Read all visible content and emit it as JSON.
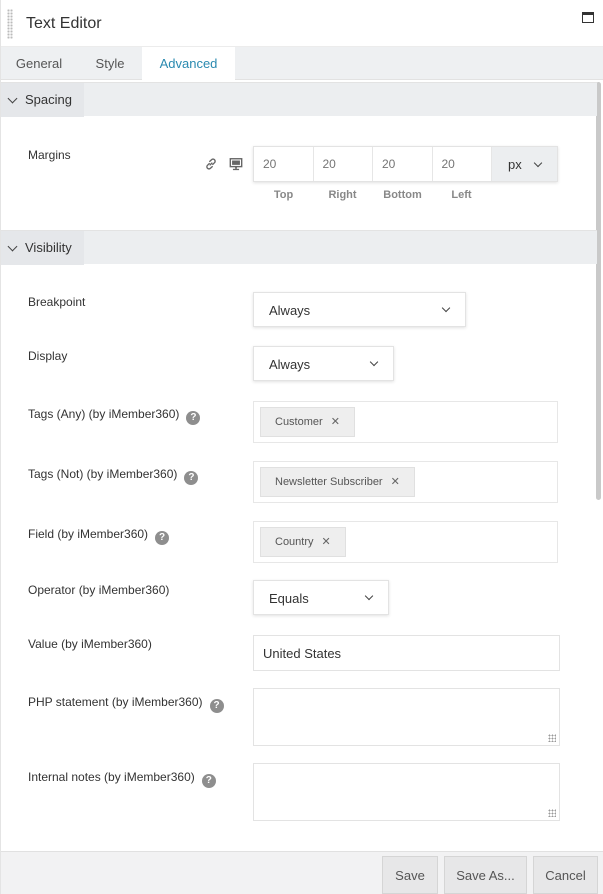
{
  "header": {
    "title": "Text Editor"
  },
  "tabs": [
    {
      "label": "General"
    },
    {
      "label": "Style"
    },
    {
      "label": "Advanced"
    }
  ],
  "active_tab": "Advanced",
  "accent_color": "#2a8ab0",
  "spacing": {
    "section_label": "Spacing",
    "margins": {
      "label": "Margins",
      "top": {
        "placeholder": "20",
        "caption": "Top"
      },
      "right": {
        "placeholder": "20",
        "caption": "Right"
      },
      "bottom": {
        "placeholder": "20",
        "caption": "Bottom"
      },
      "left": {
        "placeholder": "20",
        "caption": "Left"
      },
      "unit": "px"
    }
  },
  "visibility": {
    "section_label": "Visibility",
    "breakpoint": {
      "label": "Breakpoint",
      "value": "Always"
    },
    "display": {
      "label": "Display",
      "value": "Always"
    },
    "tags_any": {
      "label": "Tags (Any) (by iMember360)",
      "tags": [
        "Customer"
      ]
    },
    "tags_not": {
      "label": "Tags (Not) (by iMember360)",
      "tags": [
        "Newsletter Subscriber"
      ]
    },
    "field": {
      "label": "Field (by iMember360)",
      "tags": [
        "Country"
      ]
    },
    "operator": {
      "label": "Operator (by iMember360)",
      "value": "Equals"
    },
    "value": {
      "label": "Value (by iMember360)",
      "value": "United States"
    },
    "php": {
      "label": "PHP statement (by iMember360)",
      "value": ""
    },
    "notes": {
      "label": "Internal notes (by iMember360)",
      "value": ""
    }
  },
  "help_glyph": "?",
  "tag_remove_glyph": "✕",
  "footer": {
    "save": "Save",
    "save_as": "Save As...",
    "cancel": "Cancel"
  }
}
